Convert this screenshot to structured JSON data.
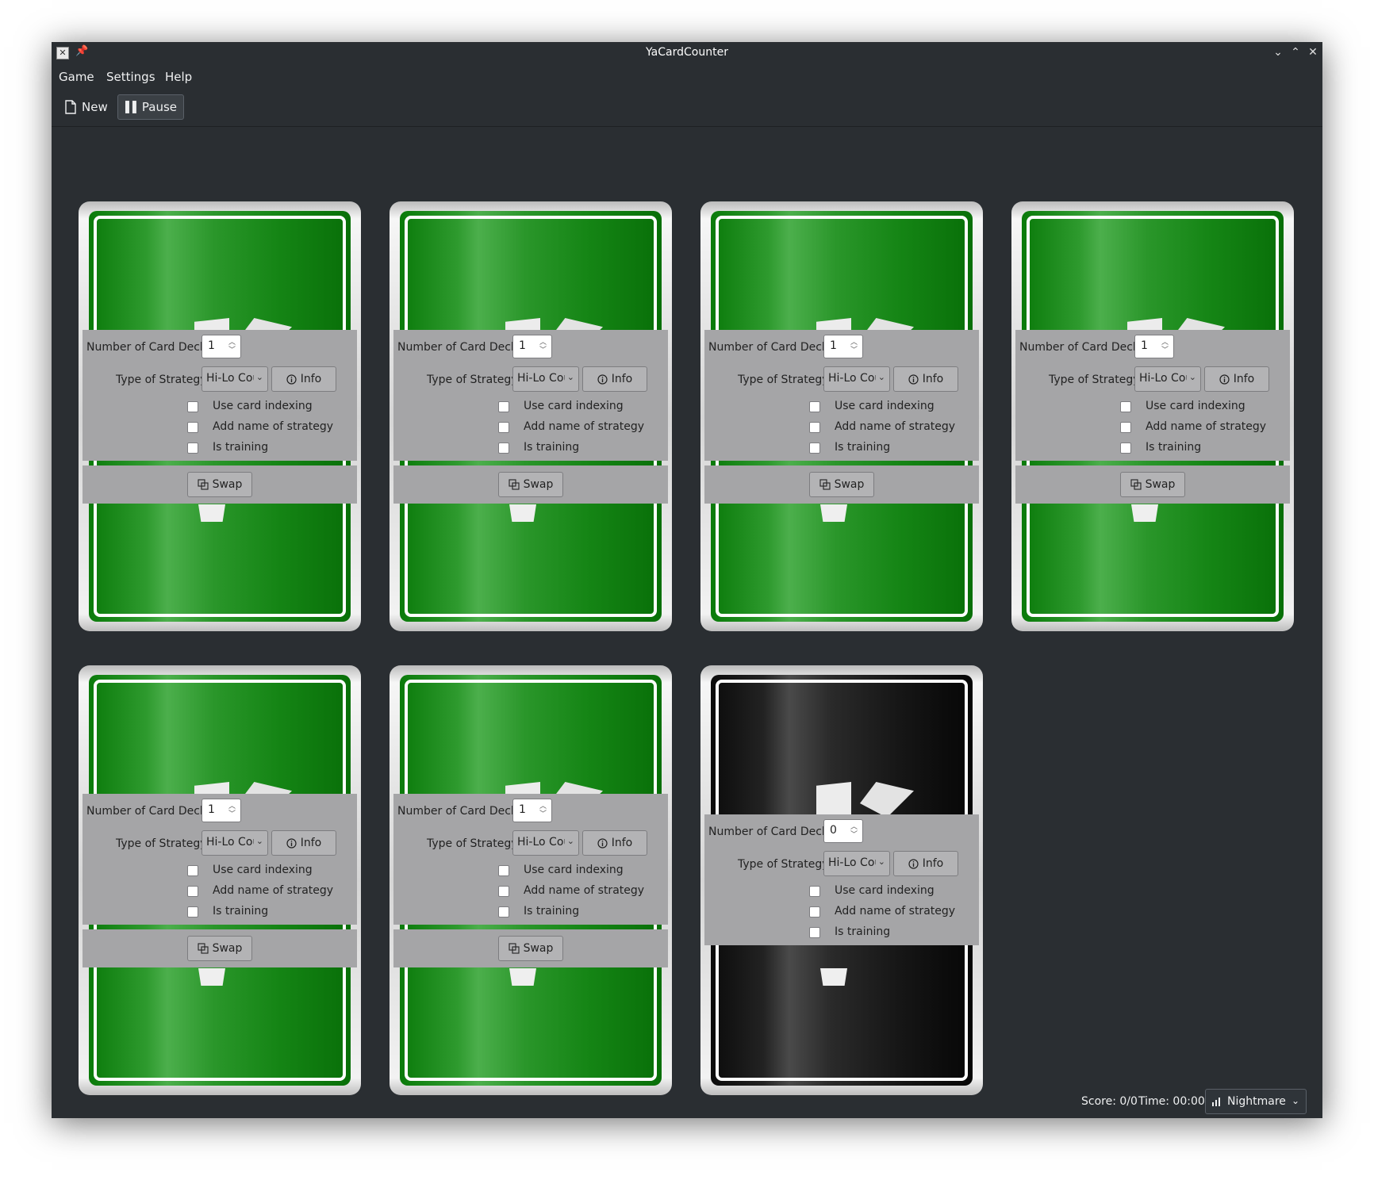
{
  "window": {
    "title": "YaCardCounter"
  },
  "menu": {
    "items": [
      "Game",
      "Settings",
      "Help"
    ]
  },
  "toolbar": {
    "new_label": "New",
    "pause_label": "Pause"
  },
  "panel_labels": {
    "decks": "Number of Card Decks:",
    "strategy": "Type of Strategy:",
    "info": "Info",
    "indexing": "Use card indexing",
    "add_name": "Add name of strategy",
    "training": "Is training",
    "swap": "Swap"
  },
  "cards": [
    {
      "color": "green",
      "decks": "1",
      "strategy": "Hi-Lo Count",
      "swap": true
    },
    {
      "color": "green",
      "decks": "1",
      "strategy": "Hi-Lo Count",
      "swap": true
    },
    {
      "color": "green",
      "decks": "1",
      "strategy": "Hi-Lo Count",
      "swap": true
    },
    {
      "color": "green",
      "decks": "1",
      "strategy": "Hi-Lo Count",
      "swap": true
    },
    {
      "color": "green",
      "decks": "1",
      "strategy": "Hi-Lo Count",
      "swap": true
    },
    {
      "color": "green",
      "decks": "1",
      "strategy": "Hi-Lo Count",
      "swap": true
    },
    {
      "color": "black",
      "decks": "0",
      "strategy": "Hi-Lo Count",
      "swap": false
    }
  ],
  "status": {
    "score": "Score: 0/0",
    "time": "Time: 00:00",
    "difficulty": "Nightmare"
  },
  "colors": {
    "window_bg": "#2a2e32",
    "card_green": "#1f8f1f",
    "panel_grey": "#a5a5a7"
  }
}
